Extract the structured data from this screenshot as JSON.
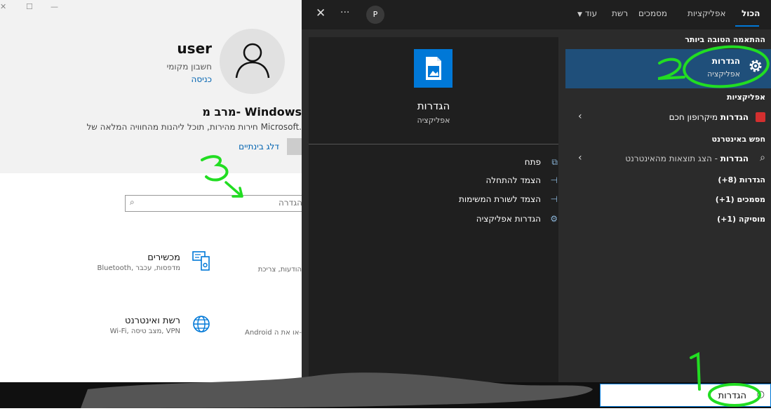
{
  "settings_window": {
    "username": "user",
    "account_type": "חשבון מקומי",
    "sign_in": "כניסה",
    "welcome_title": "מרב מ- Windows",
    "welcome_desc": "חירות מהירות, תוכל ליהנות מהחוויה המלאה של Microsoft.",
    "skip_button": "דלג בינתיים",
    "search_placeholder": "הגדרה",
    "categories": [
      {
        "title": "מכשירים",
        "subtitle": "Bluetooth, מדפסות, עכבר"
      },
      {
        "title": "",
        "subtitle": "הודעות, צריכת"
      },
      {
        "title": "רשת ואינטרנט",
        "subtitle": "Wi-Fi, מצב טיסה, VPN"
      },
      {
        "title": "",
        "subtitle": "Android או את ה-"
      }
    ]
  },
  "search_panel": {
    "tabs": [
      "הכול",
      "אפליקציות",
      "מסמכים",
      "רשת",
      "עוד"
    ],
    "avatar_letter": "P",
    "best_match_header": "ההתאמה הטובה ביותר",
    "best_match": {
      "title": "הגדרות",
      "subtitle": "אפליקציה"
    },
    "apps_header": "אפליקציות",
    "app_result": {
      "bold": "הגדרות",
      "rest": "מיקרופון חכם"
    },
    "web_header": "חפש באינטרנט",
    "web_result": {
      "bold": "הגדרות",
      "rest": " - הצג תוצאות מהאינטרנט"
    },
    "more_results": [
      "הגדרות (8+)",
      "מסמכים (1+)",
      "מוסיקה (1+)"
    ],
    "preview": {
      "title": "הגדרות",
      "subtitle": "אפליקציה",
      "actions": [
        "פתח",
        "הצמד להתחלה",
        "הצמד לשורת המשימות",
        "הגדרות אפליקציה"
      ]
    }
  },
  "taskbar": {
    "search_value": "הגדרות"
  },
  "annotations": [
    "1",
    "2",
    "3"
  ],
  "colors": {
    "accent": "#0078d7",
    "highlight": "#1f4f7a",
    "scribble": "#22dd22"
  }
}
